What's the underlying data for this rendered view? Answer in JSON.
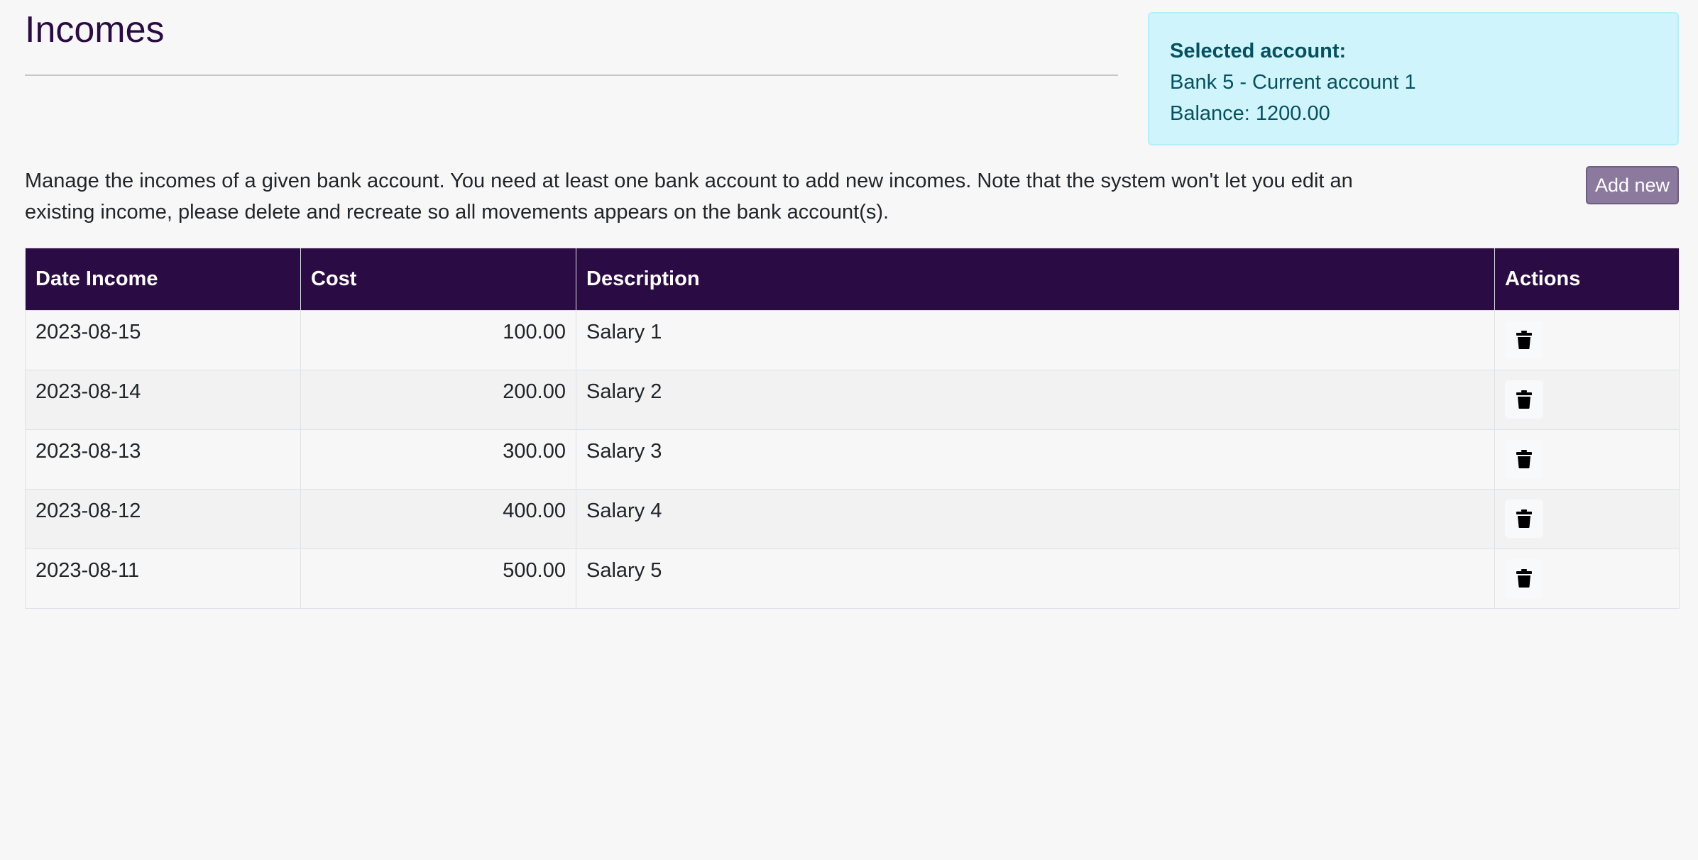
{
  "page": {
    "title": "Incomes",
    "intro": "Manage the incomes of a given bank account. You need at least one bank account to add new incomes. Note that the system won't let you edit an existing income, please delete and recreate so all movements appears on the bank account(s).",
    "add_button_label": "Add new"
  },
  "account": {
    "label": "Selected account:",
    "name": "Bank 5 - Current account 1",
    "balance": "Balance: 1200.00"
  },
  "table": {
    "headers": {
      "date": "Date Income",
      "cost": "Cost",
      "description": "Description",
      "actions": "Actions"
    },
    "rows": [
      {
        "date": "2023-08-15",
        "cost": "100.00",
        "description": "Salary 1",
        "action_icon": "trash-icon"
      },
      {
        "date": "2023-08-14",
        "cost": "200.00",
        "description": "Salary 2",
        "action_icon": "trash-icon"
      },
      {
        "date": "2023-08-13",
        "cost": "300.00",
        "description": "Salary 3",
        "action_icon": "trash-icon"
      },
      {
        "date": "2023-08-12",
        "cost": "400.00",
        "description": "Salary 4",
        "action_icon": "trash-icon"
      },
      {
        "date": "2023-08-11",
        "cost": "500.00",
        "description": "Salary 5",
        "action_icon": "trash-icon"
      }
    ]
  },
  "colors": {
    "brand": "#2a0b43",
    "info_background": "#cff4fc",
    "info_text": "#055160",
    "button": "#8b7a9d"
  }
}
